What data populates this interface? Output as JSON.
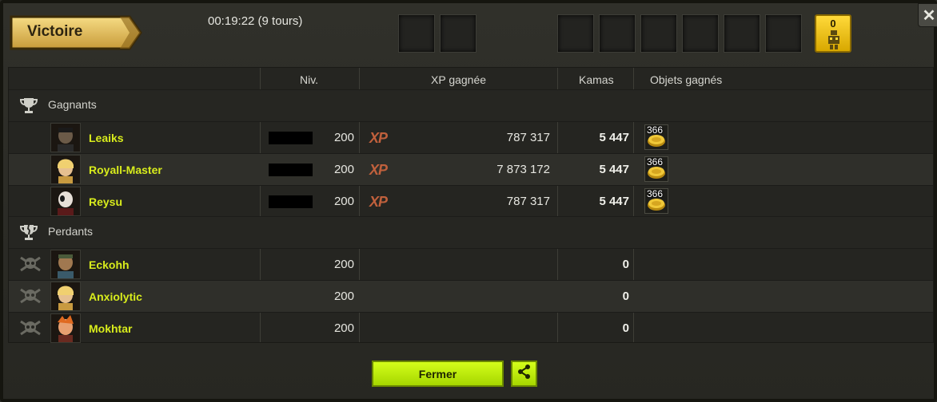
{
  "header": {
    "title": "Victoire",
    "duration": "00:19:22 (9 tours)",
    "gift_count": "0"
  },
  "columns": {
    "level": "Niv.",
    "xp": "XP gagnée",
    "kamas": "Kamas",
    "items": "Objets gagnés"
  },
  "winners": {
    "label": "Gagnants",
    "players": [
      {
        "name": "Leaiks",
        "level": "200",
        "xp_badge": "XP",
        "xp": "787 317",
        "kamas": "5 447",
        "item_count": "366"
      },
      {
        "name": "Royall-Master",
        "level": "200",
        "xp_badge": "XP",
        "xp": "7 873 172",
        "kamas": "5 447",
        "item_count": "366"
      },
      {
        "name": "Reysu",
        "level": "200",
        "xp_badge": "XP",
        "xp": "787 317",
        "kamas": "5 447",
        "item_count": "366"
      }
    ]
  },
  "losers": {
    "label": "Perdants",
    "players": [
      {
        "name": "Eckohh",
        "level": "200",
        "kamas": "0"
      },
      {
        "name": "Anxiolytic",
        "level": "200",
        "kamas": "0"
      },
      {
        "name": "Mokhtar",
        "level": "200",
        "kamas": "0"
      }
    ]
  },
  "footer": {
    "close_label": "Fermer"
  },
  "colors": {
    "player_name": "#d8ec1c",
    "button": "#c4f000",
    "xp_badge": "#c0603c"
  }
}
